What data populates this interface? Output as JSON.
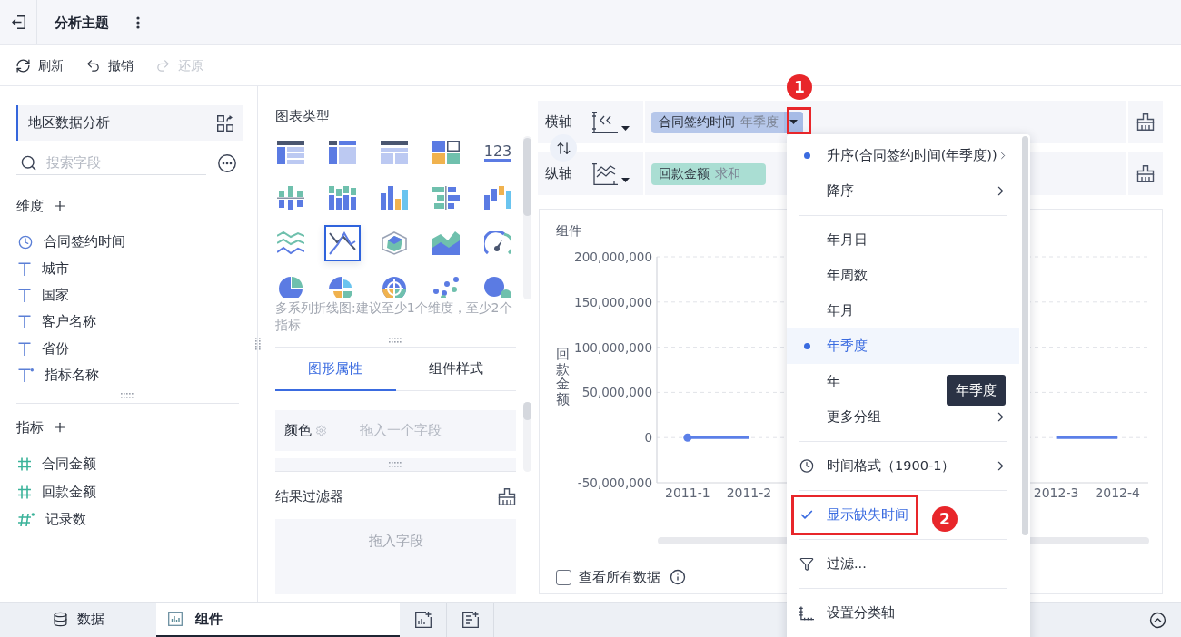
{
  "header": {
    "title": "分析主题"
  },
  "toolbar": [
    {
      "label": "刷新",
      "kind": "refresh",
      "disabled": false
    },
    {
      "label": "撤销",
      "kind": "undo",
      "disabled": false
    },
    {
      "label": "还原",
      "kind": "redo",
      "disabled": true
    }
  ],
  "data_panel": {
    "dataset": "地区数据分析",
    "search": {
      "placeholder": "搜索字段"
    },
    "dimensions": {
      "title": "维度",
      "fields": [
        {
          "name": "合同签约时间",
          "kind": "date"
        },
        {
          "name": "城市",
          "kind": "text"
        },
        {
          "name": "国家",
          "kind": "text"
        },
        {
          "name": "客户名称",
          "kind": "text"
        },
        {
          "name": "省份",
          "kind": "text"
        },
        {
          "name": "指标名称",
          "kind": "calculated"
        }
      ]
    },
    "measures": {
      "title": "指标",
      "fields": [
        {
          "name": "合同金额",
          "kind": "number"
        },
        {
          "name": "回款金额",
          "kind": "number"
        },
        {
          "name": "记录数",
          "kind": "calculated"
        }
      ]
    }
  },
  "chart_types": {
    "title": "图表类型",
    "types": [
      {
        "kind": "table",
        "selected": false
      },
      {
        "kind": "crosstab",
        "selected": false
      },
      {
        "kind": "detail",
        "selected": false
      },
      {
        "kind": "tiles",
        "selected": false
      },
      {
        "kind": "number",
        "glyph": "123",
        "selected": false
      },
      {
        "kind": "diverging",
        "selected": false
      },
      {
        "kind": "stacked",
        "selected": false
      },
      {
        "kind": "column",
        "selected": false
      },
      {
        "kind": "butterfly",
        "selected": false
      },
      {
        "kind": "floating",
        "selected": false
      },
      {
        "kind": "wave",
        "selected": false
      },
      {
        "kind": "line",
        "selected": true
      },
      {
        "kind": "radar",
        "selected": false
      },
      {
        "kind": "area",
        "selected": false
      },
      {
        "kind": "gauge",
        "selected": false
      },
      {
        "kind": "pie",
        "selected": false
      },
      {
        "kind": "rose",
        "selected": false
      },
      {
        "kind": "globe",
        "selected": false
      },
      {
        "kind": "scatter",
        "selected": false
      },
      {
        "kind": "bubble",
        "selected": false
      }
    ],
    "hint": "多系列折线图:建议至少1个维度，至少2个指标"
  },
  "property_tabs": [
    {
      "label": "图形属性",
      "selected": true
    },
    {
      "label": "组件样式",
      "selected": false
    }
  ],
  "color_slot": {
    "label": "颜色",
    "drop_hint": "拖入一个字段"
  },
  "result_filter": {
    "title": "结果过滤器",
    "drop_hint": "拖入字段"
  },
  "axes": [
    {
      "label": "横轴",
      "kind": "dimension",
      "field": "合同签约时间",
      "aggregation": "年季度",
      "menu_open": true
    },
    {
      "label": "纵轴",
      "kind": "measure",
      "field": "回款金额",
      "aggregation": "求和",
      "menu_open": false
    }
  ],
  "chart": {
    "title": "组件",
    "chart_data": {
      "type": "line",
      "ylabel": "回款金额",
      "categories": [
        "2011-1",
        "2011-2",
        null,
        null,
        null,
        null,
        "2012-3",
        "2012-4"
      ],
      "ylim": [
        -50000000,
        200000000
      ],
      "yticks": [
        {
          "value": 200000000,
          "label": "200,000,000"
        },
        {
          "value": 150000000,
          "label": "150,000,000"
        },
        {
          "value": 100000000,
          "label": "100,000,000"
        },
        {
          "value": 50000000,
          "label": "50,000,000"
        },
        {
          "value": 0,
          "label": "0"
        },
        {
          "value": -50000000,
          "label": "-50,000,000"
        }
      ],
      "grid": true,
      "series": [
        {
          "color": "#5b7fe8",
          "values": [
            0,
            0,
            null,
            null,
            null,
            null,
            0,
            0
          ]
        }
      ]
    },
    "show_all": {
      "label": "查看所有数据",
      "checked": false
    }
  },
  "axis_menu": {
    "sections": [
      {
        "items": [
          {
            "label": "升序(合同签约时间(年季度))",
            "kind": "option",
            "selected": true,
            "submenu": true
          },
          {
            "label": "降序",
            "kind": "option",
            "selected": false,
            "submenu": true
          }
        ]
      },
      {
        "items": [
          {
            "label": "年月日",
            "kind": "option",
            "selected": false,
            "hovered": false,
            "submenu": false
          },
          {
            "label": "年周数",
            "kind": "option",
            "selected": false,
            "hovered": false,
            "submenu": false
          },
          {
            "label": "年月",
            "kind": "option",
            "selected": false,
            "hovered": false,
            "submenu": false
          },
          {
            "label": "年季度",
            "kind": "option",
            "selected": true,
            "hovered": true,
            "submenu": false
          },
          {
            "label": "年",
            "kind": "option",
            "selected": false,
            "hovered": false
          },
          {
            "label": "更多分组",
            "kind": "option",
            "selected": false,
            "hovered": false,
            "submenu": true
          }
        ]
      },
      {
        "items": [
          {
            "label": "时间格式（1900-1）",
            "kind": "format",
            "submenu": true
          }
        ]
      },
      {
        "items": [
          {
            "label": "显示缺失时间",
            "kind": "toggle",
            "checked": true,
            "submenu": false
          }
        ]
      },
      {
        "items": [
          {
            "label": "过滤...",
            "kind": "filter",
            "submenu": false
          }
        ]
      },
      {
        "items": [
          {
            "label": "设置分类轴",
            "kind": "axis",
            "submenu": false
          }
        ]
      }
    ]
  },
  "tooltip": {
    "text": "年季度"
  },
  "footer_tabs": [
    {
      "label": "数据",
      "kind": "data",
      "selected": false
    },
    {
      "label": "组件",
      "kind": "component",
      "selected": true
    }
  ],
  "callouts": [
    {
      "number": "1"
    },
    {
      "number": "2"
    }
  ]
}
